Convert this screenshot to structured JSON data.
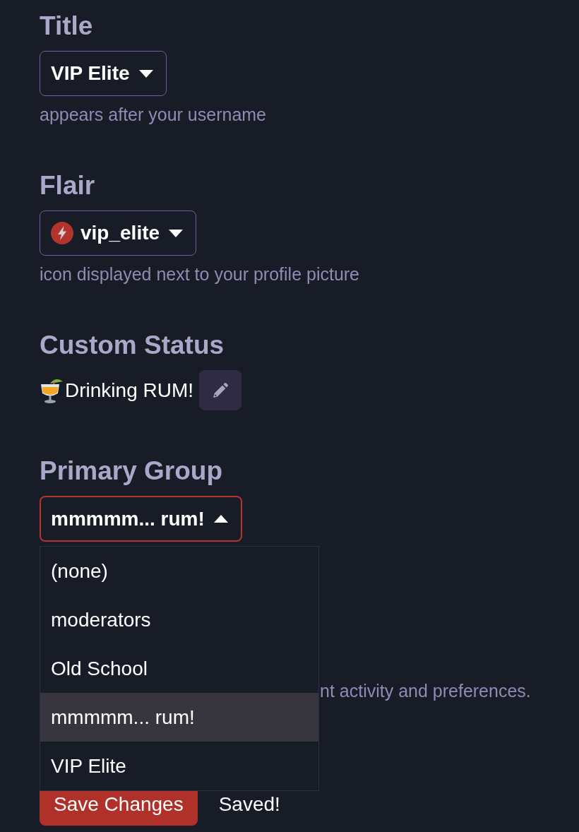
{
  "sections": [
    {
      "kind": "select",
      "label": "Title",
      "select": {
        "value": "VIP Elite",
        "expanded": false
      },
      "help": "appears after your username"
    },
    {
      "kind": "flair_select",
      "label": "Flair",
      "select": {
        "value": "vip_elite",
        "expanded": false
      },
      "help": "icon displayed next to your profile picture"
    },
    {
      "kind": "status",
      "label": "Custom Status",
      "status": {
        "text": "Drinking RUM!"
      }
    },
    {
      "kind": "select",
      "label": "Primary Group",
      "select": {
        "value": "mmmmm... rum!",
        "expanded": true,
        "options": [
          {
            "label": "(none)",
            "selected": false
          },
          {
            "label": "moderators",
            "selected": false
          },
          {
            "label": "Old School",
            "selected": false
          },
          {
            "label": "mmmmm... rum!",
            "selected": true
          },
          {
            "label": "VIP Elite",
            "selected": false
          }
        ]
      }
    }
  ],
  "footer": {
    "note": "nt activity and preferences.",
    "save_button": "Save Changes",
    "save_status": "Saved!"
  }
}
